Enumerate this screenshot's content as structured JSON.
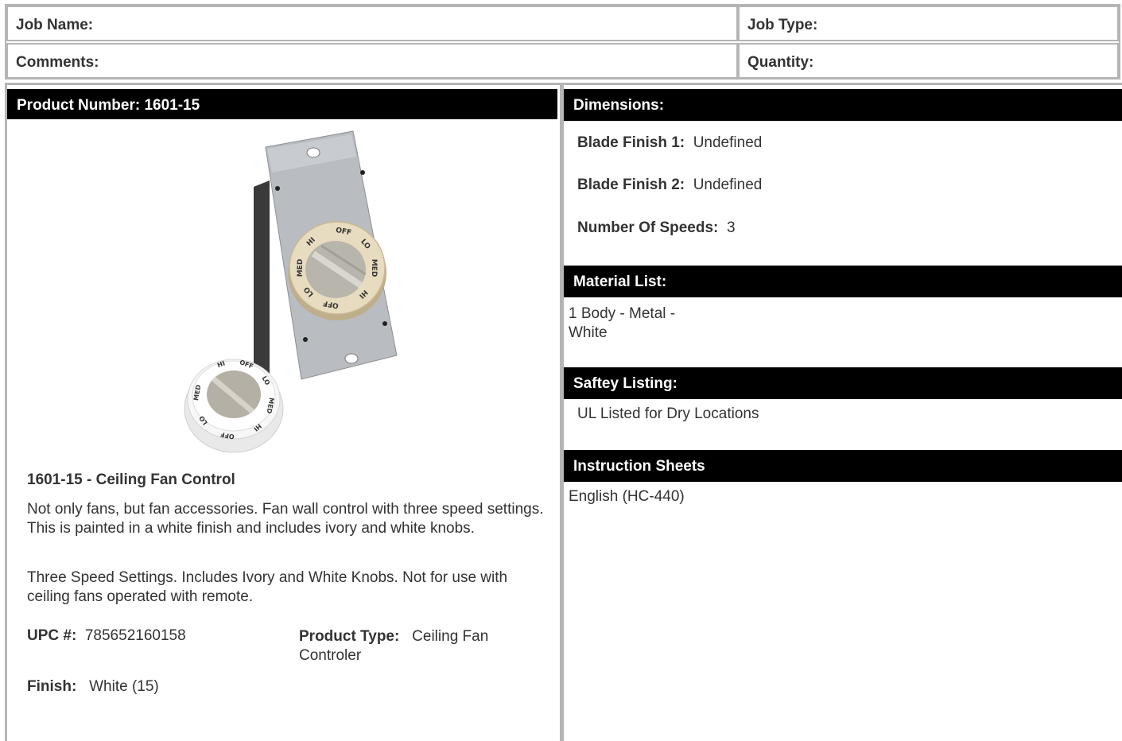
{
  "job": {
    "job_name_label": "Job Name:",
    "job_type_label": "Job Type:",
    "comments_label": "Comments:",
    "quantity_label": "Quantity:"
  },
  "product": {
    "header": "Product Number: 1601-15",
    "title": "1601-15 - Ceiling Fan Control",
    "description1": "Not only fans, but fan accessories. Fan wall control with three speed settings. This is painted in a white finish and includes ivory and white knobs.",
    "description2": "Three Speed Settings. Includes Ivory and White Knobs. Not for use with ceiling fans operated with remote.",
    "upc_label": "UPC #:",
    "upc_value": "785652160158",
    "type_label": "Product Type:",
    "type_value": "Ceiling Fan Controler",
    "finish_label": "Finish:",
    "finish_value": "White (15)"
  },
  "specs": {
    "dimensions_header": "Dimensions:",
    "blade1_label": "Blade Finish 1:",
    "blade1_value": "Undefined",
    "blade2_label": "Blade Finish 2:",
    "blade2_value": "Undefined",
    "speeds_label": "Number Of Speeds:",
    "speeds_value": "3",
    "material_header": "Material List:",
    "material_line1": "1 Body - Metal -",
    "material_line2": "White",
    "safety_header": "Saftey Listing:",
    "safety_value": "UL Listed for Dry Locations",
    "instructions_header": "Instruction Sheets",
    "instructions_link": "English (HC-440)"
  },
  "knob": {
    "labels_main": [
      "OFF",
      "LO",
      "MED",
      "HI",
      "OFF",
      "LO",
      "MED",
      "HI"
    ],
    "labels_small": [
      "HI",
      "OFF",
      "LO",
      "MED",
      "HI",
      "OFF",
      "LO",
      "MED"
    ]
  },
  "colors": {
    "header_bg": "#000000",
    "border": "#b5b5b5",
    "plate": "#b9bcc0",
    "knob_ivory": "#e8dcc0"
  }
}
